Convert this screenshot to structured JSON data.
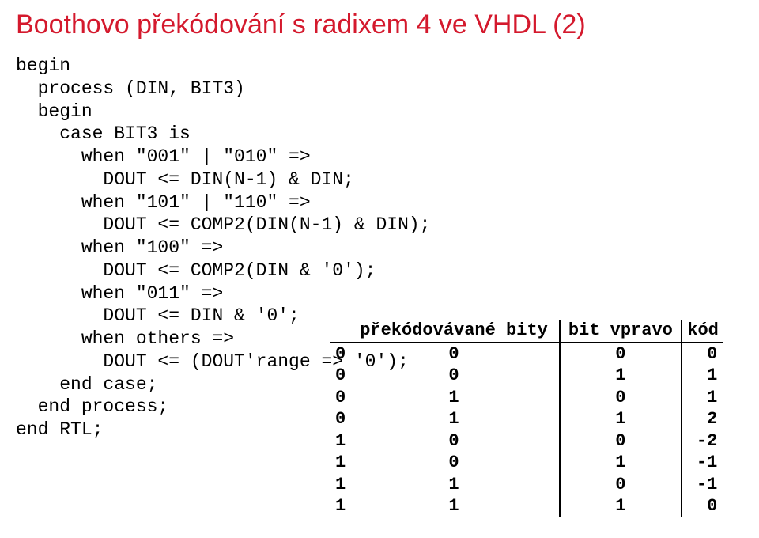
{
  "title": "Boothovo překódování s radixem 4 ve VHDL (2)",
  "code_lines": [
    "begin",
    "  process (DIN, BIT3)",
    "  begin",
    "    case BIT3 is",
    "      when \"001\" | \"010\" =>",
    "        DOUT <= DIN(N-1) & DIN;",
    "      when \"101\" | \"110\" =>",
    "        DOUT <= COMP2(DIN(N-1) & DIN);",
    "      when \"100\" =>",
    "        DOUT <= COMP2(DIN & '0');",
    "      when \"011\" =>",
    "        DOUT <= DIN & '0';",
    "      when others =>",
    "        DOUT <= (DOUT'range => '0');",
    "    end case;",
    "  end process;",
    "end RTL;"
  ],
  "chart_data": {
    "type": "table",
    "headers": [
      "překódovávané bity",
      "bit vpravo",
      "kód"
    ],
    "rows": [
      {
        "b1": "0",
        "b0": "0",
        "right": "0",
        "code": "0"
      },
      {
        "b1": "0",
        "b0": "0",
        "right": "1",
        "code": "1"
      },
      {
        "b1": "0",
        "b0": "1",
        "right": "0",
        "code": "1"
      },
      {
        "b1": "0",
        "b0": "1",
        "right": "1",
        "code": "2"
      },
      {
        "b1": "1",
        "b0": "0",
        "right": "0",
        "code": "-2"
      },
      {
        "b1": "1",
        "b0": "0",
        "right": "1",
        "code": "-1"
      },
      {
        "b1": "1",
        "b0": "1",
        "right": "0",
        "code": "-1"
      },
      {
        "b1": "1",
        "b0": "1",
        "right": "1",
        "code": "0"
      }
    ]
  }
}
